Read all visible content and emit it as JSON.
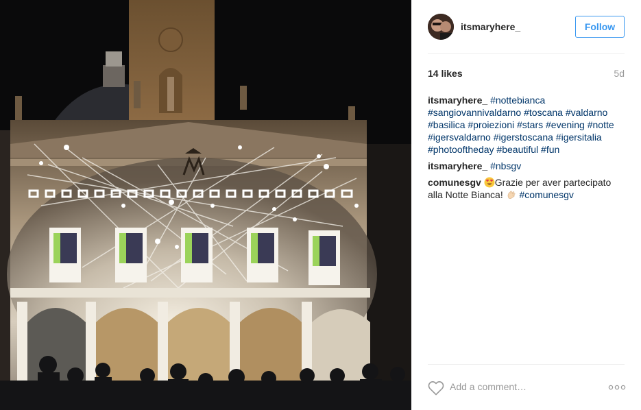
{
  "post": {
    "photo_alt": "",
    "author": "itsmaryhere_",
    "follow_label": "Follow",
    "likes": "14 likes",
    "age": "5d"
  },
  "comments": [
    {
      "user": "itsmaryhere_",
      "hashtags": [
        "#nottebianca",
        "#sangiovannivaldarno",
        "#toscana",
        "#valdarno",
        "#basilica",
        "#proiezioni",
        "#stars",
        "#evening",
        "#notte",
        "#igersvaldarno",
        "#igerstoscana",
        "#igersitalia",
        "#photooftheday",
        "#beautiful",
        "#fun"
      ]
    },
    {
      "user": "itsmaryhere_",
      "hashtags": [
        "#nbsgv"
      ]
    },
    {
      "user": "comunesgv",
      "emoji_before": "heart-eyes-emoji",
      "text": "Grazie per aver partecipato alla Notte Bianca!",
      "emoji_after": "clapping-hands-emoji",
      "hashtags": [
        "#comunesgv"
      ]
    }
  ],
  "add_comment": {
    "placeholder": "Add a comment…"
  },
  "icons": {
    "like": "heart-outline-icon",
    "more": "more-options-icon"
  },
  "colors": {
    "link": "#003569",
    "follow": "#3897f0",
    "muted": "#999999",
    "border": "#efefef"
  }
}
